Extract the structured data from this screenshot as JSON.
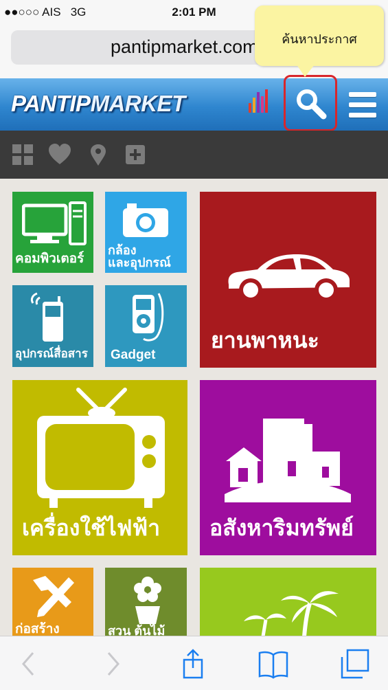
{
  "status_bar": {
    "carrier": "●●○○○ AIS",
    "network": "3G",
    "time": "2:01 PM"
  },
  "browser": {
    "url": "pantipmarket.com"
  },
  "header": {
    "logo_part1": "PANTIP",
    "logo_part2": "MARKET"
  },
  "tooltip": {
    "text": "ค้นหาประกาศ"
  },
  "toolbar": {
    "icons": [
      "grid-icon",
      "heart-icon",
      "location-pin-icon",
      "plus-icon"
    ]
  },
  "categories": [
    {
      "label": "คอมพิวเตอร์",
      "color": "#27a33a",
      "icon": "computer-icon"
    },
    {
      "label_line1": "กล้อง",
      "label_line2": "และอุปกรณ์",
      "color": "#2fa6e6",
      "icon": "camera-icon"
    },
    {
      "label": "ยานพาหนะ",
      "color": "#a81a1e",
      "icon": "car-icon"
    },
    {
      "label": "อุปกรณ์สื่อสาร",
      "color": "#2a8aa8",
      "icon": "phone-icon"
    },
    {
      "label": "Gadget",
      "color": "#2e98bf",
      "icon": "ipod-icon"
    },
    {
      "label": "เครื่องใช้ไฟฟ้า",
      "color": "#c1bb00",
      "icon": "tv-icon"
    },
    {
      "label": "อสังหาริมทรัพย์",
      "color": "#9e0d9e",
      "icon": "buildings-icon"
    },
    {
      "label": "ก่อสร้าง",
      "color": "#e89a19",
      "icon": "tools-icon"
    },
    {
      "label": "สวน ต้นไม้",
      "color": "#6f8c2c",
      "icon": "plant-icon"
    },
    {
      "label": "",
      "color": "#97c91e",
      "icon": "palm-tree-icon"
    }
  ],
  "bottom_nav": [
    "back-icon",
    "forward-icon",
    "share-icon",
    "bookmarks-icon",
    "tabs-icon"
  ]
}
